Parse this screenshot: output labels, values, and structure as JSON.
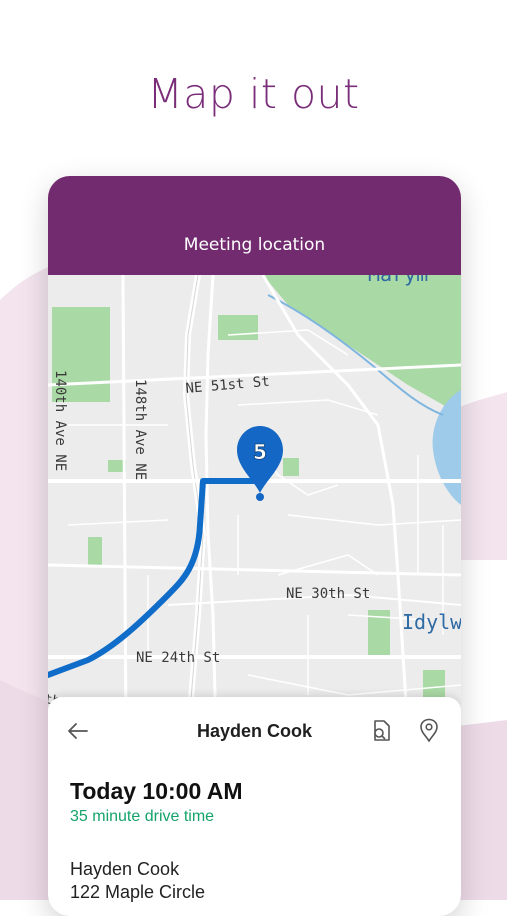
{
  "headline": "Map it out",
  "header": {
    "title": "Meeting location"
  },
  "map": {
    "pin_label": "5",
    "street_labels": {
      "ne51": "NE 51st St",
      "ave148": "148th Ave NE",
      "ave140": "140th Ave NE",
      "ne30": "NE 30th St",
      "ne24": "NE 24th St",
      "idylwood": "Idylw",
      "marymoor": "Marym",
      "partial": "th St"
    },
    "colors": {
      "route": "#0f6cc9",
      "pin": "#1467c4",
      "park": "#a9d9a4",
      "water": "#9ecbe9"
    }
  },
  "sheet": {
    "name": "Hayden Cook",
    "time": "Today 10:00 AM",
    "drive": "35 minute drive time",
    "contact_name": "Hayden Cook",
    "address": "122 Maple Circle"
  },
  "colors": {
    "brand": "#732b70",
    "accent_green": "#15a36a"
  }
}
